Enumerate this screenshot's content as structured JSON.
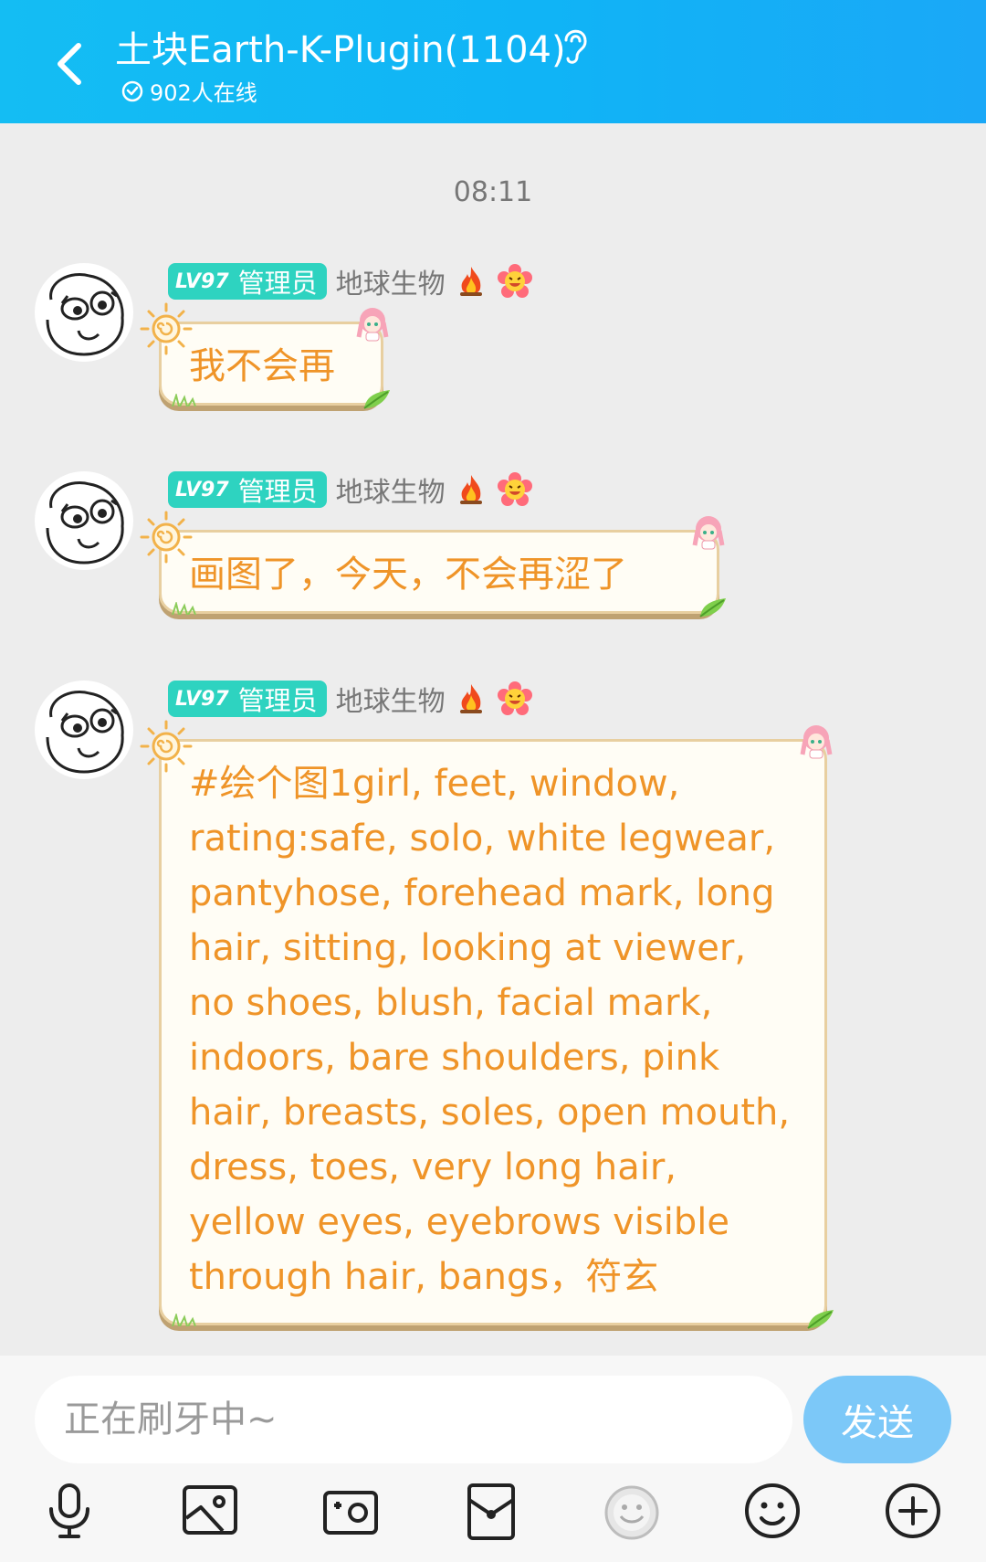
{
  "header": {
    "title": "土块Earth-K-Plugin(1104)",
    "online": "902人在线"
  },
  "chat": {
    "time": "08:11",
    "messages": [
      {
        "level": "LV97",
        "role": "管理员",
        "nickname": "地球生物",
        "text": "我不会再"
      },
      {
        "level": "LV97",
        "role": "管理员",
        "nickname": "地球生物",
        "text": "画图了，今天，不会再涩了"
      },
      {
        "level": "LV97",
        "role": "管理员",
        "nickname": "地球生物",
        "text": "#绘个图1girl, feet, window, rating:safe, solo, white legwear, pantyhose, forehead mark, long hair, sitting, looking at viewer, no shoes, blush, facial mark, indoors, bare shoulders, pink hair, breasts, soles, open mouth, dress, toes, very long hair, yellow eyes, eyebrows visible through hair, bangs，符玄"
      }
    ]
  },
  "input": {
    "placeholder": "正在刷牙中~",
    "send_label": "发送"
  },
  "toolbar": {
    "icons": [
      "microphone-icon",
      "image-icon",
      "camera-icon",
      "red-packet-icon",
      "sticker-icon",
      "emoji-icon",
      "plus-icon"
    ]
  },
  "colors": {
    "header": "#10b4f6",
    "bubble_text": "#ef9428",
    "level_badge": "#2ed3c0",
    "send_button": "#7cc8f8"
  }
}
